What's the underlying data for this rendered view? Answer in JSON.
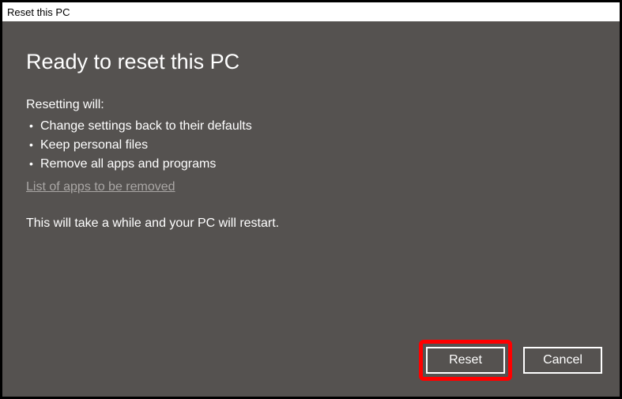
{
  "window": {
    "title": "Reset this PC"
  },
  "heading": "Ready to reset this PC",
  "subheading": "Resetting will:",
  "bullets": {
    "0": "Change settings back to their defaults",
    "1": "Keep personal files",
    "2": "Remove all apps and programs"
  },
  "link": "List of apps to be removed",
  "note": "This will take a while and your PC will restart.",
  "buttons": {
    "reset": "Reset",
    "cancel": "Cancel"
  }
}
